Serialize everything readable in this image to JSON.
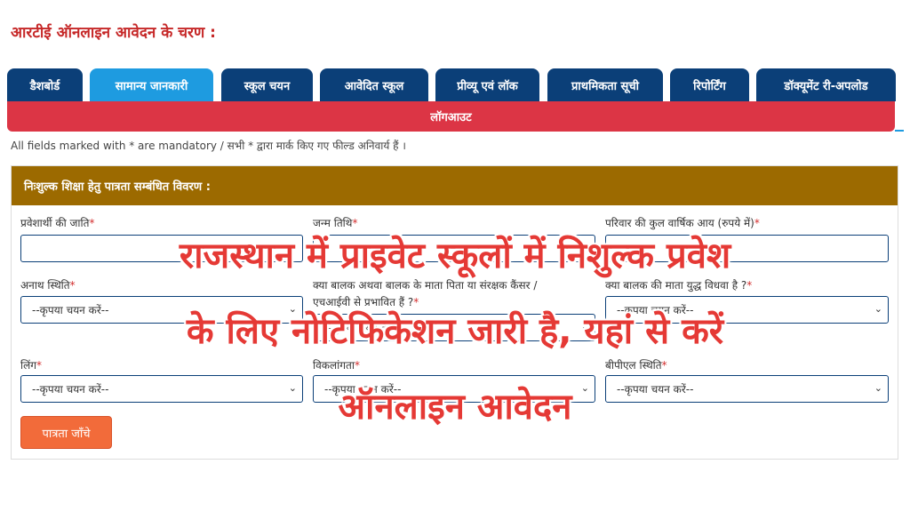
{
  "page_heading": "आरटीई ऑनलाइन आवेदन के चरण :",
  "tabs": [
    {
      "label": "डैशबोर्ड",
      "active": false
    },
    {
      "label": "सामान्य जानकारी",
      "active": true
    },
    {
      "label": "स्कूल चयन",
      "active": false
    },
    {
      "label": "आवेदित स्कूल",
      "active": false
    },
    {
      "label": "प्रीव्यू एवं लॉक",
      "active": false
    },
    {
      "label": "प्राथमिकता सूची",
      "active": false
    },
    {
      "label": "रिपोर्टिंग",
      "active": false
    },
    {
      "label": "डॉक्यूमेंट री-अपलोड",
      "active": false
    }
  ],
  "logout_label": "लॉगआउट",
  "mandatory_note": "All fields marked with * are mandatory / सभी * द्वारा मार्क किए गए फील्ड अनिवार्य हैं ।",
  "form": {
    "section_title": "निःशुल्क शिक्षा हेतु पात्रता सम्बंधित विवरण :",
    "fields": {
      "caste": {
        "label": "प्रवेशार्थी की जाति",
        "required": "*"
      },
      "dob": {
        "label": "जन्म तिथि",
        "required": "*"
      },
      "income": {
        "label": "परिवार की कुल वार्षिक आय (रुपये में)",
        "required": "*"
      },
      "orphan": {
        "label": "अनाथ स्थिति",
        "required": "*",
        "value": "--कृपया चयन करें--"
      },
      "cancer_hiv": {
        "label_line1": "क्या बालक अथवा बालक के माता पिता या संरक्षक कैंसर /",
        "label_line2": "एचआईवी से प्रभावित हैं ?",
        "required": "*",
        "value": "--कृपया चयन करें--"
      },
      "war_widow": {
        "label": "क्या बालक की माता युद्ध विधवा है ?",
        "required": "*",
        "value": "--कृपया चयन करें--"
      },
      "gender": {
        "label": "लिंग",
        "required": "*",
        "value": "--कृपया चयन करें--"
      },
      "disability": {
        "label": "विकलांगता",
        "required": "*",
        "value": "--कृपया चयन करें--"
      },
      "bpl": {
        "label": "बीपीएल स्थिति",
        "required": "*",
        "value": "--कृपया चयन करें--"
      }
    },
    "check_button": "पात्रता जाँचे"
  },
  "overlay": {
    "line1": "राजस्थान में प्राइवेट स्कूलों में निशुल्क प्रवेश",
    "line2": "के लिए नोटिफिकेशन जारी है, यहां से करें",
    "line3": "ऑनलाइन आवेदन"
  },
  "colors": {
    "heading_red": "#c62828",
    "tab_navy": "#0b3f78",
    "tab_active": "#1e9be0",
    "logout_red": "#dc3545",
    "card_header": "#9c6a00",
    "button_orange": "#f26b3a",
    "overlay_red": "#e53935"
  },
  "icons": {
    "select_chevron": "chevron-down-icon"
  }
}
